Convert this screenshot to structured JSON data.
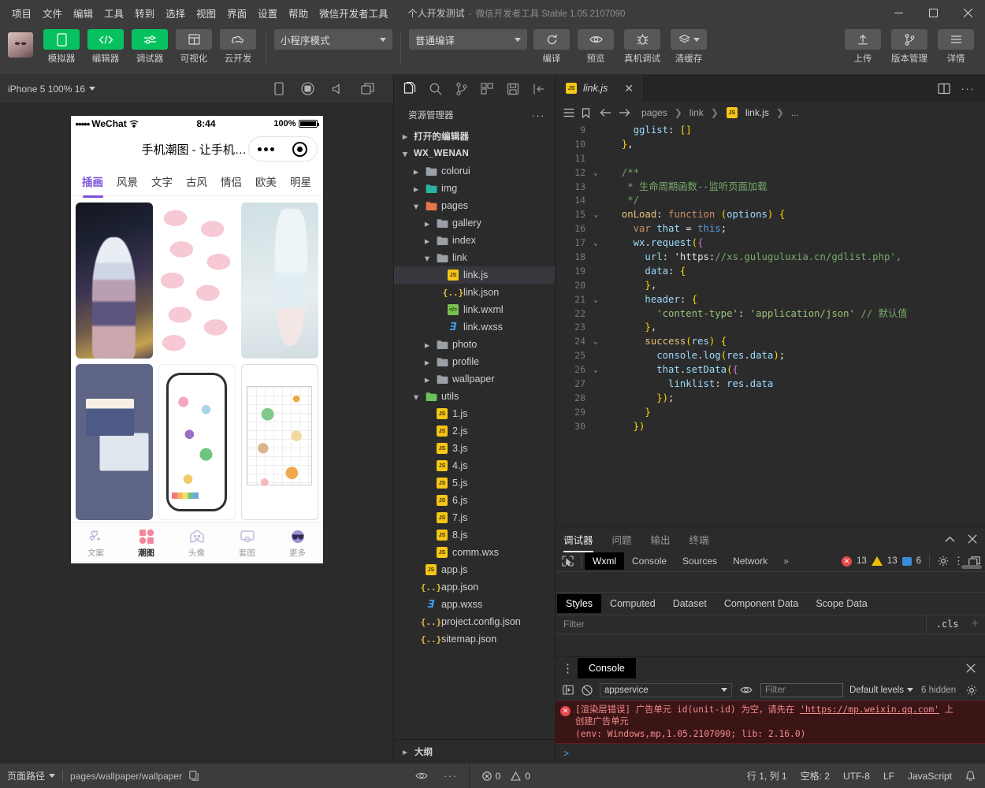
{
  "titlebar": {
    "menus": [
      "项目",
      "文件",
      "编辑",
      "工具",
      "转到",
      "选择",
      "视图",
      "界面",
      "设置",
      "帮助",
      "微信开发者工具"
    ],
    "project_name": "个人开发测试",
    "dash": "-",
    "app_name": "微信开发者工具 Stable 1.05.2107090",
    "minimize": "minimize-icon",
    "maximize": "maximize-icon",
    "close": "close-icon"
  },
  "toolbar": {
    "buttons": [
      {
        "label": "模拟器",
        "icon": "phone-icon",
        "style": "green"
      },
      {
        "label": "编辑器",
        "icon": "code-icon",
        "style": "green"
      },
      {
        "label": "调试器",
        "icon": "debug-sliders-icon",
        "style": "green"
      },
      {
        "label": "可视化",
        "icon": "layout-icon",
        "style": "grey"
      },
      {
        "label": "云开发",
        "icon": "cloud-icon",
        "style": "grey"
      }
    ],
    "mode_select": "小程序模式",
    "compile_select": "普通编译",
    "actions": [
      {
        "label": "编译",
        "icon": "refresh-icon"
      },
      {
        "label": "预览",
        "icon": "eye-icon"
      },
      {
        "label": "真机调试",
        "icon": "bug-icon"
      },
      {
        "label": "清缓存",
        "icon": "layers-icon"
      }
    ],
    "right_actions": [
      {
        "label": "上传",
        "icon": "upload-icon"
      },
      {
        "label": "版本管理",
        "icon": "git-branch-icon"
      },
      {
        "label": "详情",
        "icon": "hamburger-icon"
      }
    ]
  },
  "simulator": {
    "device_label": "iPhone 5 100% 16",
    "icons": [
      "phone-rotate-icon",
      "record-icon",
      "volume-icon",
      "window-icon"
    ],
    "phone": {
      "carrier": "WeChat",
      "dots": "•••••",
      "time": "8:44",
      "battery_pct": "100%",
      "page_title": "手机潮图 - 让手机秀...",
      "capsule": [
        "more-dots-icon",
        "target-icon"
      ],
      "tabs": [
        "插画",
        "风景",
        "文字",
        "古风",
        "情侣",
        "欧美",
        "明星"
      ],
      "active_tab": "插画",
      "cards": [
        {
          "name": "anime-girl-card"
        },
        {
          "name": "cinnamoroll-pattern-card"
        },
        {
          "name": "pastel-hand-card"
        },
        {
          "name": "photo-frames-card"
        },
        {
          "name": "doodle-stickers-card"
        },
        {
          "name": "animal-grid-card"
        }
      ],
      "tabbar": [
        {
          "label": "文案",
          "icon": "hearts-icon",
          "active": false
        },
        {
          "label": "潮图",
          "icon": "grid-squares-icon",
          "active": true
        },
        {
          "label": "头像",
          "icon": "ghost-icon",
          "active": false
        },
        {
          "label": "套图",
          "icon": "frame-icon",
          "active": false
        },
        {
          "label": "更多",
          "icon": "sunglasses-icon",
          "active": false
        }
      ]
    }
  },
  "explorer": {
    "activity_icons": [
      "files-icon",
      "search-icon",
      "source-control-icon",
      "extensions-icon",
      "save-icon",
      "collapse-icon"
    ],
    "title": "资源管理器",
    "more": "more-icon",
    "open_editors": "打开的编辑器",
    "project_root": "WX_WENAN",
    "outline": "大纲",
    "tree": [
      {
        "label": "colorui",
        "type": "folder",
        "depth": 1,
        "open": false,
        "tag": "grey"
      },
      {
        "label": "img",
        "type": "folder",
        "depth": 1,
        "open": false,
        "tag": "teal"
      },
      {
        "label": "pages",
        "type": "folder",
        "depth": 1,
        "open": true,
        "tag": "orange"
      },
      {
        "label": "gallery",
        "type": "folder",
        "depth": 2,
        "open": false,
        "tag": "grey"
      },
      {
        "label": "index",
        "type": "folder",
        "depth": 2,
        "open": false,
        "tag": "grey"
      },
      {
        "label": "link",
        "type": "folder",
        "depth": 2,
        "open": true,
        "tag": "grey"
      },
      {
        "label": "link.js",
        "type": "js",
        "depth": 3,
        "selected": true
      },
      {
        "label": "link.json",
        "type": "json",
        "depth": 3
      },
      {
        "label": "link.wxml",
        "type": "wxml",
        "depth": 3
      },
      {
        "label": "link.wxss",
        "type": "wxss",
        "depth": 3
      },
      {
        "label": "photo",
        "type": "folder",
        "depth": 2,
        "open": false,
        "tag": "grey"
      },
      {
        "label": "profile",
        "type": "folder",
        "depth": 2,
        "open": false,
        "tag": "grey"
      },
      {
        "label": "wallpaper",
        "type": "folder",
        "depth": 2,
        "open": false,
        "tag": "grey"
      },
      {
        "label": "utils",
        "type": "folder",
        "depth": 1,
        "open": true,
        "tag": "green"
      },
      {
        "label": "1.js",
        "type": "js",
        "depth": 2
      },
      {
        "label": "2.js",
        "type": "js",
        "depth": 2
      },
      {
        "label": "3.js",
        "type": "js",
        "depth": 2
      },
      {
        "label": "4.js",
        "type": "js",
        "depth": 2
      },
      {
        "label": "5.js",
        "type": "js",
        "depth": 2
      },
      {
        "label": "6.js",
        "type": "js",
        "depth": 2
      },
      {
        "label": "7.js",
        "type": "js",
        "depth": 2
      },
      {
        "label": "8.js",
        "type": "js",
        "depth": 2
      },
      {
        "label": "comm.wxs",
        "type": "js",
        "depth": 2
      },
      {
        "label": "app.js",
        "type": "js",
        "depth": 1
      },
      {
        "label": "app.json",
        "type": "json",
        "depth": 1
      },
      {
        "label": "app.wxss",
        "type": "wxss",
        "depth": 1
      },
      {
        "label": "project.config.json",
        "type": "json",
        "depth": 1
      },
      {
        "label": "sitemap.json",
        "type": "json",
        "depth": 1
      }
    ]
  },
  "editor": {
    "tab_name": "link.js",
    "tab_close": "close-icon",
    "split_icon": "split-editor-icon",
    "more_icon": "more-icon",
    "breadcrumb": [
      "pages",
      "link",
      "link.js",
      "..."
    ],
    "bc_icons": [
      "outline-list-icon",
      "bookmark-icon",
      "back-arrow-icon",
      "forward-arrow-icon"
    ],
    "lines": [
      {
        "n": 9,
        "fold": "",
        "text": "    gglist: []"
      },
      {
        "n": 10,
        "fold": "",
        "text": "  },"
      },
      {
        "n": 11,
        "fold": "",
        "text": ""
      },
      {
        "n": 12,
        "fold": "v",
        "text": "  /**"
      },
      {
        "n": 13,
        "fold": "",
        "text": "   * 生命周期函数--监听页面加载"
      },
      {
        "n": 14,
        "fold": "",
        "text": "   */"
      },
      {
        "n": 15,
        "fold": "v",
        "text": "  onLoad: function (options) {"
      },
      {
        "n": 16,
        "fold": "",
        "text": "    var that = this;"
      },
      {
        "n": 17,
        "fold": "v",
        "text": "    wx.request({"
      },
      {
        "n": 18,
        "fold": "",
        "text": "      url: 'https://xs.guluguluxia.cn/gdlist.php',"
      },
      {
        "n": 19,
        "fold": "",
        "text": "      data: {"
      },
      {
        "n": 20,
        "fold": "",
        "text": "      },"
      },
      {
        "n": 21,
        "fold": "v",
        "text": "      header: {"
      },
      {
        "n": 22,
        "fold": "",
        "text": "        'content-type': 'application/json' // 默认值"
      },
      {
        "n": 23,
        "fold": "",
        "text": "      },"
      },
      {
        "n": 24,
        "fold": "v",
        "text": "      success(res) {"
      },
      {
        "n": 25,
        "fold": "",
        "text": "        console.log(res.data);"
      },
      {
        "n": 26,
        "fold": "v",
        "text": "        that.setData({"
      },
      {
        "n": 27,
        "fold": "",
        "text": "          linklist: res.data"
      },
      {
        "n": 28,
        "fold": "",
        "text": "        });"
      },
      {
        "n": 29,
        "fold": "",
        "text": "      }"
      },
      {
        "n": 30,
        "fold": "",
        "text": "    })"
      }
    ]
  },
  "debugger": {
    "panel_tabs": [
      "调试器",
      "问题",
      "输出",
      "终端"
    ],
    "panel_active": "调试器",
    "collapse_icon": "chevron-up-icon",
    "close_icon": "close-icon",
    "inspect_icon": "inspect-element-icon",
    "devtools_tabs": [
      "Wxml",
      "Console",
      "Sources",
      "Network"
    ],
    "devtools_active": "Wxml",
    "overflow": "»",
    "errors": "13",
    "warnings": "13",
    "messages": "6",
    "gear_icon": "gear-icon",
    "kebab_icon": "more-vertical-icon",
    "dock_icon": "dock-icon",
    "style_tabs": [
      "Styles",
      "Computed",
      "Dataset",
      "Component Data",
      "Scope Data"
    ],
    "style_active": "Styles",
    "filter_placeholder": "Filter",
    "cls_label": ".cls",
    "plus": "+"
  },
  "console": {
    "kebab_icon": "more-vertical-icon",
    "tab": "Console",
    "close_icon": "close-icon",
    "sidebar_icon": "console-sidebar-icon",
    "clear_icon": "clear-console-icon",
    "context": "appservice",
    "eye_icon": "eye-icon",
    "filter_placeholder": "Filter",
    "levels": "Default levels",
    "hidden": "6 hidden",
    "gear_icon": "gear-icon",
    "error_line1_a": "[渲染层错误] 广告单元 id(unit-id) 为空，请先在 ",
    "error_link": "https://mp.weixin.qq.com",
    "error_line1_b": " 上",
    "error_line2": "创建广告单元",
    "error_line3": "(env: Windows,mp,1.05.2107090; lib: 2.16.0)",
    "prompt": ">"
  },
  "status": {
    "page_path_label": "页面路径",
    "page_path": "pages/wallpaper/wallpaper",
    "copy_icon": "copy-icon",
    "eye_icon": "eye-icon",
    "more_icon": "more-icon",
    "errors": "0",
    "warnings": "0",
    "cursor": "行 1, 列 1",
    "spaces": "空格: 2",
    "encoding": "UTF-8",
    "eol": "LF",
    "language": "JavaScript",
    "bell_icon": "bell-icon"
  },
  "colors": {
    "accent_green": "#07c160",
    "tab_active_purple": "#7b4fd8",
    "error_red": "#e5484d",
    "warning_yellow": "#f0c000",
    "info_blue": "#3b8ad8"
  }
}
